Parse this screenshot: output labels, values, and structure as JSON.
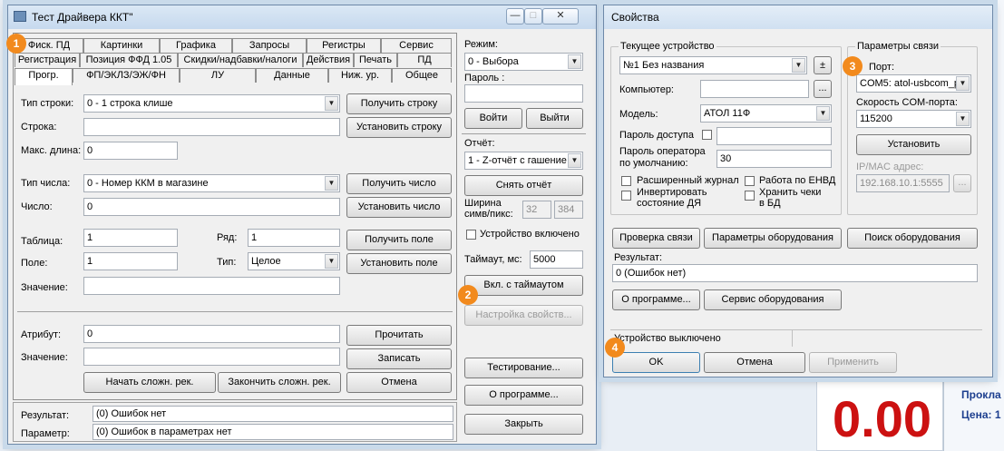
{
  "left_window": {
    "title": "Тест Драйвера ККТ\"",
    "tabs_row1": [
      "Фиск. ПД",
      "Картинки",
      "Графика",
      "Запросы",
      "Регистры",
      "Сервис"
    ],
    "tabs_row2": [
      "Регистрация",
      "Позиция ФФД 1.05",
      "Скидки/надбавки/налоги",
      "Действия",
      "Печать",
      "ПД"
    ],
    "tabs_row3": [
      "Прогр.",
      "ФП/ЭКЛЗ/ЭЖ/ФН",
      "ЛУ",
      "Данные",
      "Ниж. ур.",
      "Общее"
    ],
    "line_type_label": "Тип строки:",
    "line_type_value": "0 - 1 строка клише",
    "get_line_button": "Получить строку",
    "line_label": "Строка:",
    "line_value": "",
    "set_line_button": "Установить строку",
    "max_len_label": "Макс. длина:",
    "max_len_value": "0",
    "number_type_label": "Тип числа:",
    "number_type_value": "0 - Номер ККМ в магазине",
    "get_number_button": "Получить число",
    "number_label": "Число:",
    "number_value": "0",
    "set_number_button": "Установить число",
    "table_label": "Таблица:",
    "table_value": "1",
    "row_label": "Ряд:",
    "row_value": "1",
    "get_field_button": "Получить поле",
    "field_label": "Поле:",
    "field_value": "1",
    "type_label": "Тип:",
    "type_value": "Целое",
    "set_field_button": "Установить поле",
    "value_label": "Значение:",
    "value_value": "",
    "attribute_label": "Атрибут:",
    "attribute_value": "0",
    "read_button": "Прочитать",
    "value2_label": "Значение:",
    "value2_value": "",
    "write_button": "Записать",
    "start_complex_button": "Начать сложн. рек.",
    "end_complex_button": "Закончить сложн. рек.",
    "cancel_button": "Отмена",
    "mode_label": "Режим:",
    "mode_value": "0 - Выбора",
    "password_label": "Пароль :",
    "password_value": "",
    "login_button": "Войти",
    "logout_button": "Выйти",
    "report_label": "Отчёт:",
    "report_value": "1 - Z-отчёт с гашение",
    "take_report_button": "Снять отчёт",
    "width_label": "Ширина симв/пикс:",
    "width_chars": "32",
    "width_pixels": "384",
    "device_enabled_label": "Устройство включено",
    "timeout_label": "Таймаут, мс:",
    "timeout_value": "5000",
    "timeout_button": "Вкл. с таймаутом",
    "settings_button": "Настройка свойств...",
    "testing_button": "Тестирование...",
    "about_button": "О программе...",
    "close_button": "Закрыть",
    "result_label": "Результат:",
    "result_value": "(0) Ошибок нет",
    "param_label": "Параметр:",
    "param_value": "(0) Ошибок в параметрах нет"
  },
  "right_window": {
    "title": "Свойства",
    "current_device_group": "Текущее устройство",
    "device_value": "№1 Без названия",
    "plus_minus": "±",
    "computer_label": "Компьютер:",
    "computer_value": "",
    "dots": "...",
    "model_label": "Модель:",
    "model_value": "АТОЛ 11Ф",
    "access_password_label": "Пароль доступа",
    "access_password_value": "",
    "operator_password_label": "Пароль оператора по умолчанию:",
    "operator_password_value": "30",
    "extended_journal_label": "Расширенный журнал",
    "envd_label": "Работа по ЕНВД",
    "invert_label": "Инвертировать состояние ДЯ",
    "store_receipts_label": "Хранить чеки в БД",
    "connection_group": "Параметры связи",
    "port_label": "Порт:",
    "port_value": "COM5: atol-usbcom_p",
    "baud_label": "Скорость COM-порта:",
    "baud_value": "115200",
    "install_button": "Установить",
    "ip_label": "IP/MAC адрес:",
    "ip_value": "192.168.10.1:5555",
    "check_connection_button": "Проверка связи",
    "equipment_params_button": "Параметры оборудования",
    "search_equipment_button": "Поиск оборудования",
    "result_label": "Результат:",
    "result_value": "0 (Ошибок нет)",
    "about_button": "О программе...",
    "equipment_service_button": "Сервис оборудования",
    "status_text": "Устройство выключено",
    "ok_button": "OK",
    "cancel_button": "Отмена",
    "apply_button": "Применить"
  },
  "background": {
    "amount": "0.00",
    "side_text_1": "Прокла",
    "side_text_2": "Цена: 1"
  },
  "badges": [
    "1",
    "2",
    "3",
    "4"
  ],
  "colors": {
    "badge": "#f28a1d",
    "amount": "#cc1111",
    "side_text": "#1d3f8f"
  }
}
